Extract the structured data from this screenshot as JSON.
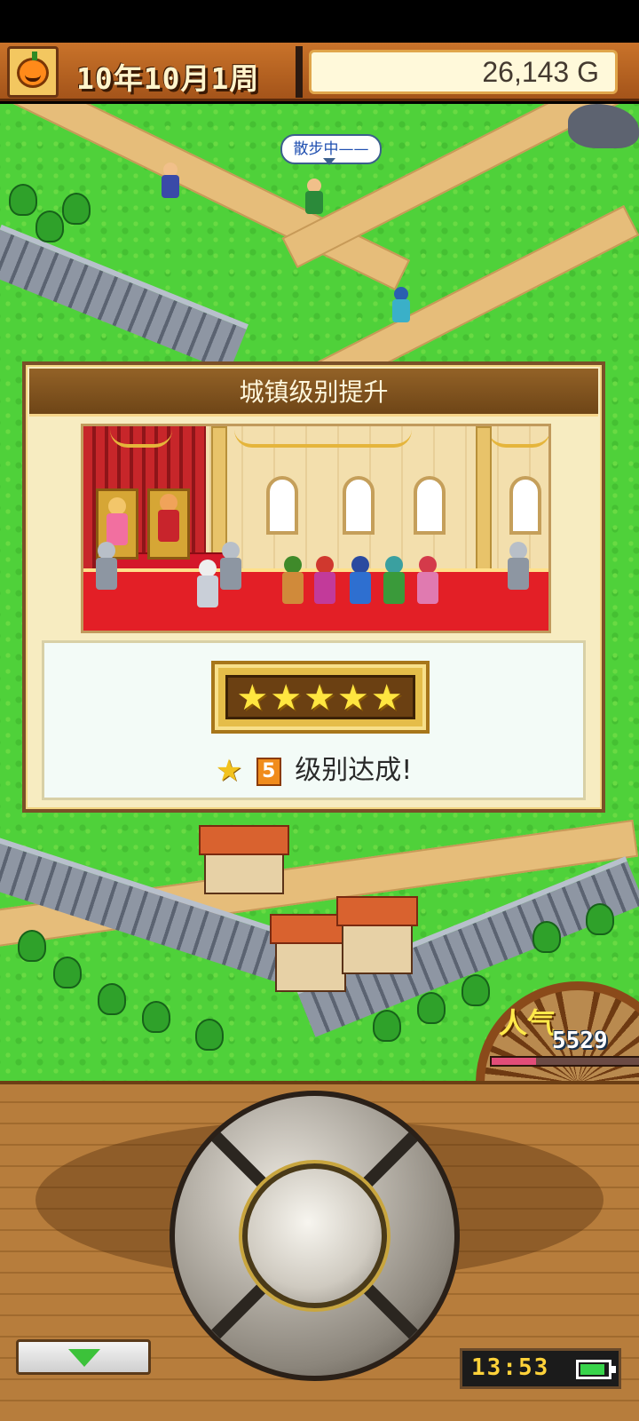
{
  "hud": {
    "date": "10年10月1周",
    "gold": "26,143 G",
    "menu_icon": "pumpkin-icon"
  },
  "map": {
    "speech_bubble": "散步中——",
    "popularity_label": "人气",
    "popularity_value": "5529",
    "popularity_level": 0.3
  },
  "dialog": {
    "title": "城镇级别提升",
    "stars": "★★★★★",
    "star_icon": "★",
    "level": "5",
    "achieve_text": "级别达成!"
  },
  "bottom": {
    "clock": "13:53",
    "battery_level": 0.9,
    "toggle_icon": "chevron-down-icon"
  },
  "colors": {
    "hud_bg": "#b8632a",
    "grass": "#4fd13a",
    "dialog_bg": "#f7ecc1",
    "star": "#ffe640",
    "carpet": "#e31f26"
  }
}
